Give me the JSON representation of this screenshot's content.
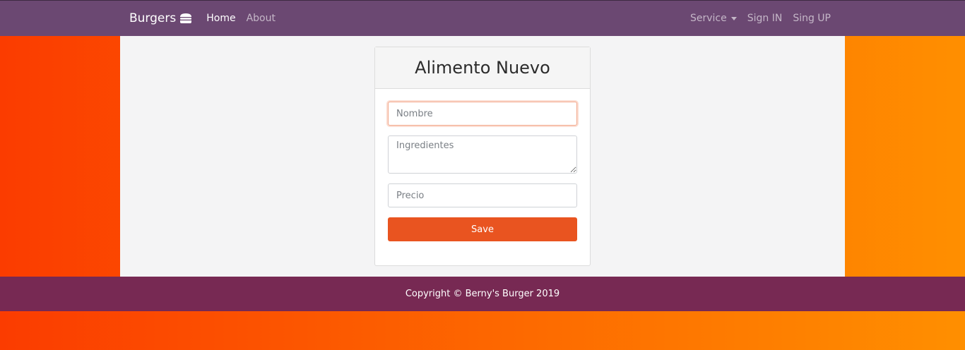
{
  "navbar": {
    "brand": "Burgers",
    "brand_icon": "hamburger-icon",
    "links": [
      {
        "label": "Home",
        "active": true
      },
      {
        "label": "About",
        "active": false
      }
    ],
    "right": {
      "service": "Service",
      "sign_in": "Sign IN",
      "sign_up": "Sing UP"
    }
  },
  "form": {
    "title": "Alimento Nuevo",
    "nombre_placeholder": "Nombre",
    "ingredientes_placeholder": "Ingredientes",
    "precio_placeholder": "Precio",
    "save_label": "Save"
  },
  "footer": {
    "text": "Copyright © Berny's Burger 2019"
  },
  "colors": {
    "navbar": "#6b4872",
    "footer": "#772953",
    "accent": "#e95420",
    "bg_left": "#fb3c00",
    "bg_right": "#ff8f00"
  }
}
